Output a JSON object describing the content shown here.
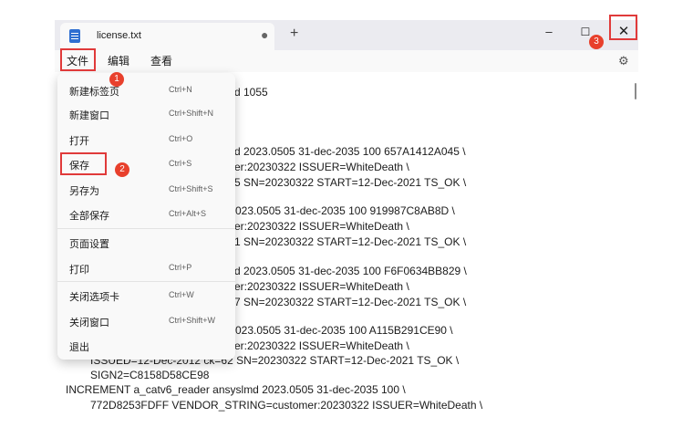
{
  "tab": {
    "title": "license.txt",
    "dot": "●",
    "new_tab": "+"
  },
  "window_controls": {
    "minimize": "–",
    "maximize": "☐",
    "close": "✕"
  },
  "menu": {
    "file": "文件",
    "edit": "编辑",
    "view": "查看"
  },
  "file_menu": [
    {
      "label": "新建标签页",
      "shortcut": "Ctrl+N"
    },
    {
      "label": "新建窗口",
      "shortcut": "Ctrl+Shift+N"
    },
    {
      "label": "打开",
      "shortcut": "Ctrl+O"
    },
    {
      "label": "保存",
      "shortcut": "Ctrl+S"
    },
    {
      "label": "另存为",
      "shortcut": "Ctrl+Shift+S"
    },
    {
      "label": "全部保存",
      "shortcut": "Ctrl+Alt+S"
    },
    {
      "label": "页面设置",
      "shortcut": ""
    },
    {
      "label": "打印",
      "shortcut": "Ctrl+P"
    },
    {
      "label": "关闭选项卡",
      "shortcut": "Ctrl+W"
    },
    {
      "label": "关闭窗口",
      "shortcut": "Ctrl+Shift+W"
    },
    {
      "label": "退出",
      "shortcut": ""
    }
  ],
  "badges": [
    "1",
    "2",
    "3"
  ],
  "editor_lines": [
    "d 1055",
    "d 2023.0505 31-dec-2035 100 657A1412A045 \\",
    "er:20230322 ISSUER=WhiteDeath \\",
    "5 SN=20230322 START=12-Dec-2021 TS_OK \\",
    "023.0505 31-dec-2035 100 919987C8AB8D \\",
    "er:20230322 ISSUER=WhiteDeath \\",
    "1 SN=20230322 START=12-Dec-2021 TS_OK \\",
    "d 2023.0505 31-dec-2035 100 F6F0634BB829 \\",
    "er:20230322 ISSUER=WhiteDeath \\",
    "7 SN=20230322 START=12-Dec-2021 TS_OK \\",
    "023.0505 31-dec-2035 100 A115B291CE90 \\",
    "er:20230322 ISSUER=WhiteDeath \\",
    "ISSUED=12-Dec-2012 ck=62 SN=20230322 START=12-Dec-2021 TS_OK \\",
    "SIGN2=C8158D58CE98",
    "INCREMENT a_catv6_reader ansyslmd 2023.0505 31-dec-2035 100 \\",
    "772D8253FDFF VENDOR_STRING=customer:20230322 ISSUER=WhiteDeath \\"
  ]
}
